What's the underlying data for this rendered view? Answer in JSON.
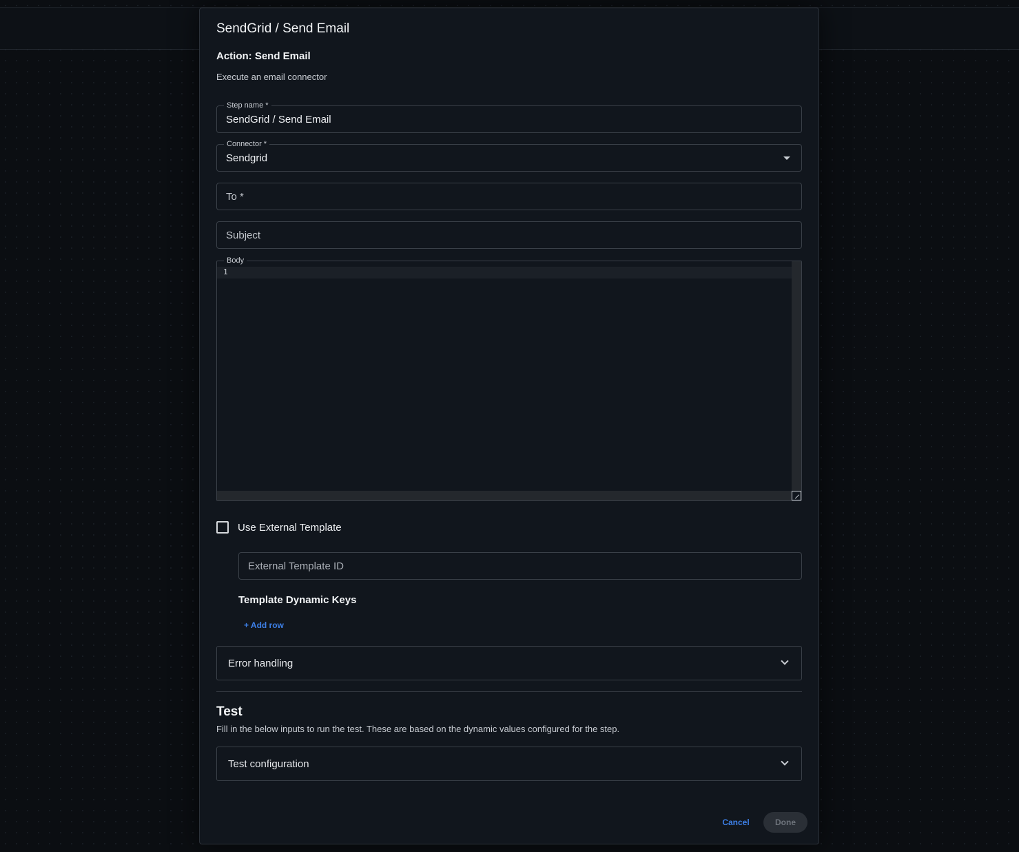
{
  "modal": {
    "title": "SendGrid / Send Email",
    "action_title": "Action: Send Email",
    "action_description": "Execute an email connector"
  },
  "form": {
    "step_name": {
      "label": "Step name *",
      "value": "SendGrid / Send Email"
    },
    "connector": {
      "label": "Connector *",
      "value": "Sendgrid"
    },
    "to": {
      "placeholder": "To *"
    },
    "subject": {
      "placeholder": "Subject"
    },
    "body": {
      "label": "Body",
      "line_numbers": [
        "1"
      ]
    },
    "use_external_template": {
      "label": "Use External Template",
      "checked": false
    },
    "external_template_id": {
      "placeholder": "External Template ID"
    },
    "template_dynamic_keys": {
      "title": "Template Dynamic Keys",
      "add_row_label": "+ Add row"
    },
    "error_handling": {
      "label": "Error handling"
    }
  },
  "test": {
    "title": "Test",
    "description": "Fill in the below inputs to run the test. These are based on the dynamic values configured for the step.",
    "configuration_label": "Test configuration"
  },
  "footer": {
    "cancel_label": "Cancel",
    "done_label": "Done"
  },
  "colors": {
    "accent": "#3d7fe6",
    "modal_background": "#11161d",
    "page_background": "#0b0e12"
  }
}
